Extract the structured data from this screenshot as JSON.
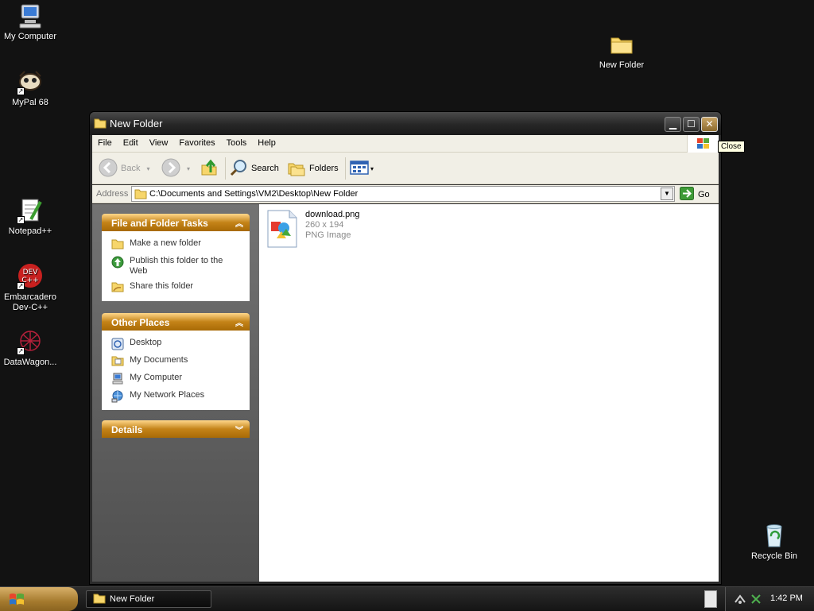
{
  "desktop": {
    "icons": [
      {
        "label": "My Computer"
      },
      {
        "label": "MyPal 68"
      },
      {
        "label": "Notepad++"
      },
      {
        "label": "Embarcadero Dev-C++"
      },
      {
        "label": "DataWagon..."
      },
      {
        "label": "New Folder"
      },
      {
        "label": "Recycle Bin"
      }
    ]
  },
  "window": {
    "title": "New Folder",
    "menu": [
      "File",
      "Edit",
      "View",
      "Favorites",
      "Tools",
      "Help"
    ],
    "toolbar": {
      "back": "Back",
      "search": "Search",
      "folders": "Folders"
    },
    "address": {
      "label": "Address",
      "value": "C:\\Documents and Settings\\VM2\\Desktop\\New Folder",
      "go": "Go"
    },
    "tasks_panel": {
      "title": "File and Folder Tasks",
      "items": [
        "Make a new folder",
        "Publish this folder to the Web",
        "Share this folder"
      ]
    },
    "places_panel": {
      "title": "Other Places",
      "items": [
        "Desktop",
        "My Documents",
        "My Computer",
        "My Network Places"
      ]
    },
    "details_panel": {
      "title": "Details"
    },
    "files": [
      {
        "name": "download.png",
        "dimensions": "260 x 194",
        "type": "PNG Image"
      }
    ]
  },
  "tooltip": "Close",
  "taskbar": {
    "task_label": "New Folder",
    "clock": "1:42 PM"
  },
  "colors": {
    "panel_header": "#c48318",
    "taskbar": "#1a1a1a",
    "desktop": "#121212"
  }
}
